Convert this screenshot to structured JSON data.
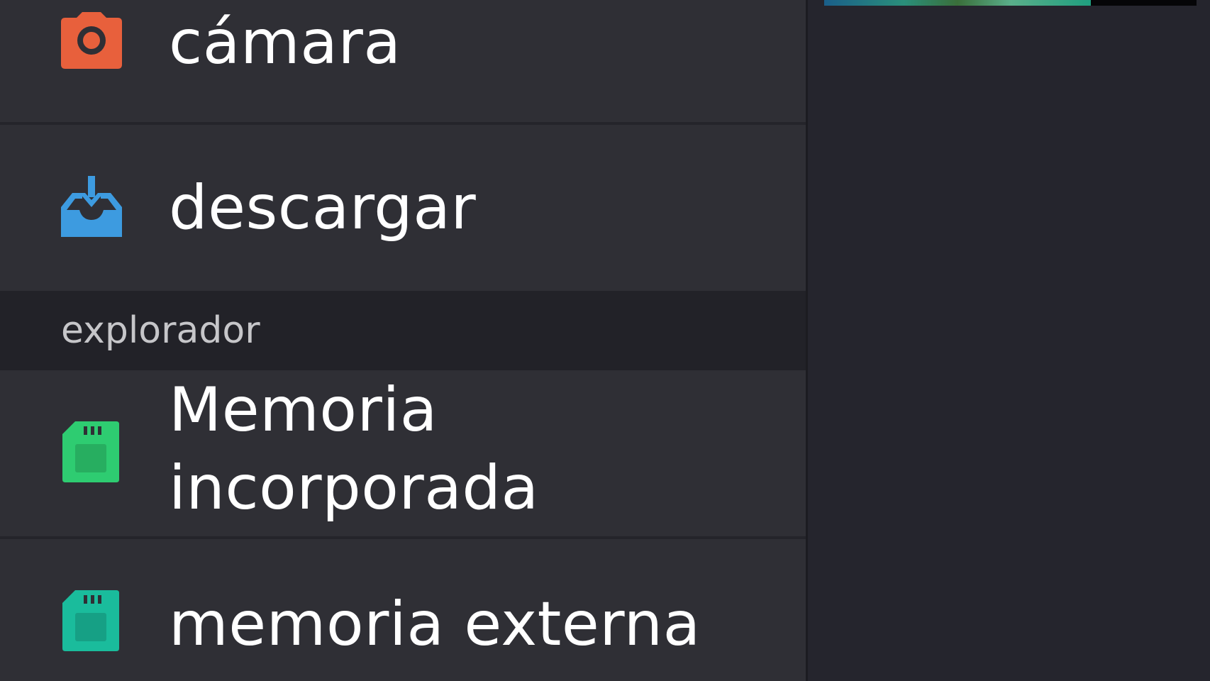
{
  "drawer": {
    "items": [
      {
        "label": "cámara",
        "icon": "camera-icon",
        "icon_color": "#e8603c"
      },
      {
        "label": "descargar",
        "icon": "download-tray-icon",
        "icon_color": "#3d9be0"
      }
    ],
    "section_header": "explorador",
    "storage": [
      {
        "label_line1": "Memoria",
        "label_line2": "incorporada",
        "icon": "sd-card-icon",
        "icon_color": "#2ecc71"
      },
      {
        "label": "memoria externa",
        "icon": "sd-card-icon",
        "icon_color": "#1abc9c"
      }
    ]
  },
  "colors": {
    "drawer_bg": "#2f2f35",
    "section_bg": "#222228",
    "content_bg": "#25252d"
  }
}
